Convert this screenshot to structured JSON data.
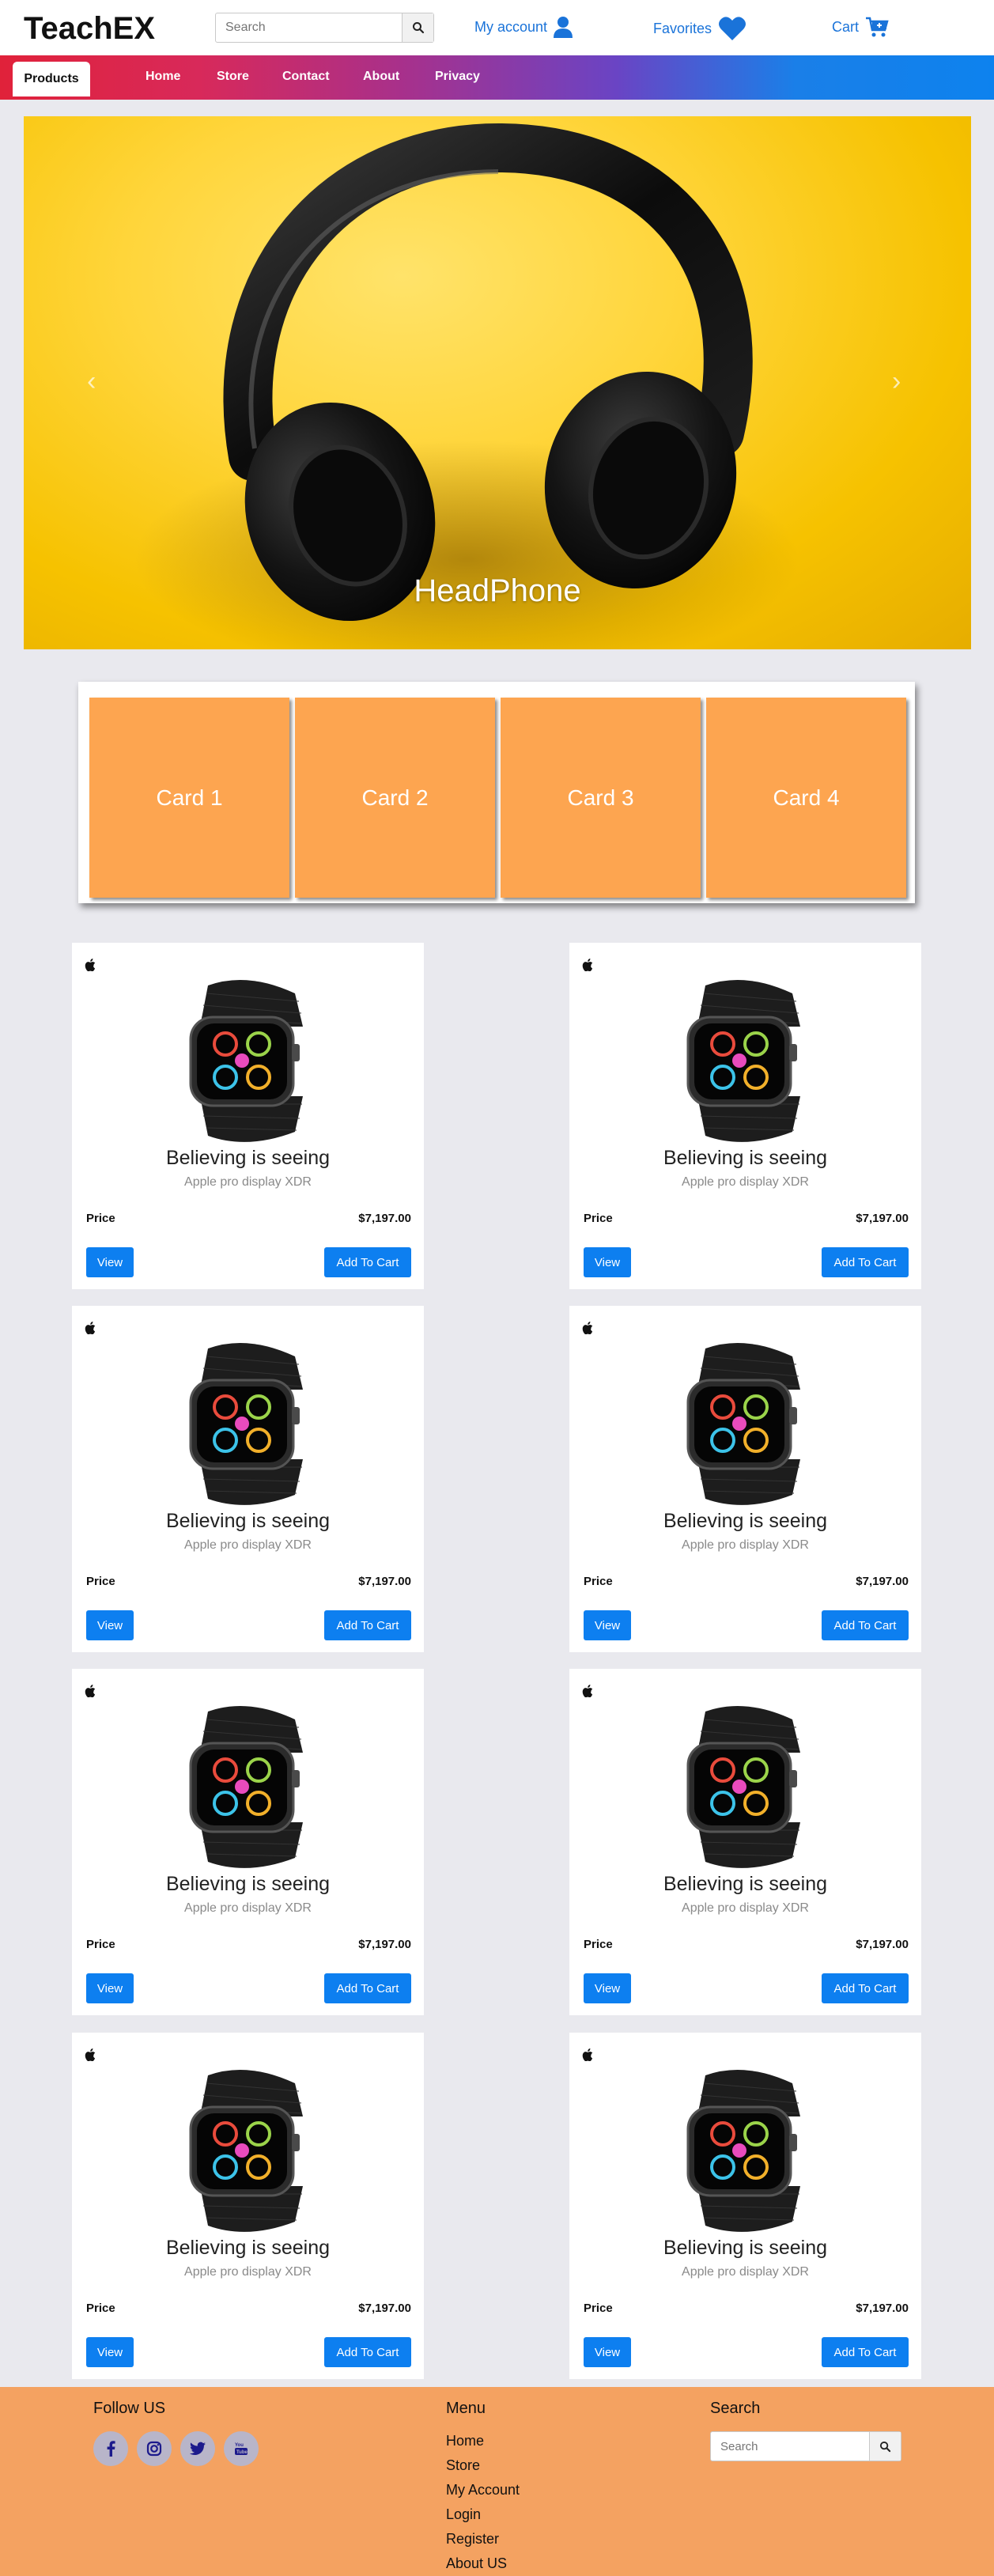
{
  "brand": "TeachEX",
  "header": {
    "search_placeholder": "Search",
    "my_account": "My account",
    "favorites": "Favorites",
    "cart": "Cart"
  },
  "nav": {
    "items": [
      "Products",
      "Home",
      "Store",
      "Contact",
      "About",
      "Privacy"
    ],
    "active": "Products"
  },
  "hero": {
    "caption": "HeadPhone",
    "slide_count": 3,
    "active_slide": 2
  },
  "cards": [
    "Card 1",
    "Card 2",
    "Card 3",
    "Card 4"
  ],
  "product": {
    "title": "Believing is seeing",
    "subtitle": "Apple pro display XDR",
    "price_label": "Price",
    "price": "$7,197.00",
    "view_label": "View",
    "cart_label": "Add To Cart",
    "count": 8
  },
  "footer": {
    "follow_title": "Follow US",
    "social_icons": [
      "facebook-icon",
      "instagram-icon",
      "twitter-icon",
      "youtube-icon"
    ],
    "menu_title": "Menu",
    "menu_items": [
      "Home",
      "Store",
      "My Account",
      "Login",
      "Register",
      "About US"
    ],
    "search_title": "Search",
    "search_placeholder": "Search"
  },
  "colors": {
    "accent": "#0d7ff0",
    "link": "#1a73d9",
    "card": "#fda550",
    "footer": "#f4a261",
    "page_bg": "#e9e9ee"
  }
}
